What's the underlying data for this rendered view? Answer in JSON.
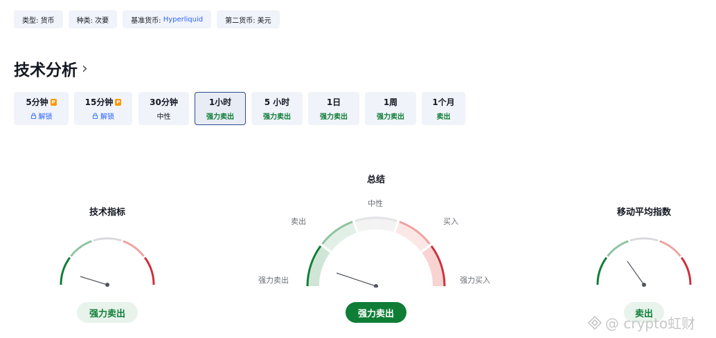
{
  "tags": [
    {
      "label": "类型:",
      "value": "货币"
    },
    {
      "label": "种类:",
      "value": "次要"
    },
    {
      "label": "基准货币:",
      "value": "Hyperliquid"
    },
    {
      "label": "第二货币:",
      "value": "美元"
    }
  ],
  "section_title": "技术分析",
  "timeframes": [
    {
      "label": "5分钟",
      "status": "解锁",
      "locked": true
    },
    {
      "label": "15分钟",
      "status": "解锁",
      "locked": true
    },
    {
      "label": "30分钟",
      "status": "中性"
    },
    {
      "label": "1小时",
      "status": "强力卖出",
      "active": true
    },
    {
      "label": "5 小时",
      "status": "强力卖出"
    },
    {
      "label": "1日",
      "status": "强力卖出"
    },
    {
      "label": "1周",
      "status": "强力卖出"
    },
    {
      "label": "1个月",
      "status": "卖出"
    }
  ],
  "gauges": {
    "oscillators": {
      "title": "技术指标",
      "result": "强力卖出"
    },
    "summary": {
      "title": "总结",
      "result": "强力卖出",
      "labels": {
        "strong_sell": "强力卖出",
        "sell": "卖出",
        "neutral": "中性",
        "buy": "买入",
        "strong_buy": "强力买入"
      }
    },
    "moving_averages": {
      "title": "移动平均指数",
      "result": "卖出"
    }
  },
  "watermark": "@ crypto虹财",
  "colors": {
    "strong_sell": "#0f7d36",
    "sell": "#8fc3a0",
    "neutral": "#d9dadd",
    "buy": "#eea39f",
    "strong_buy": "#cc2f3c",
    "link": "#2962ff"
  }
}
